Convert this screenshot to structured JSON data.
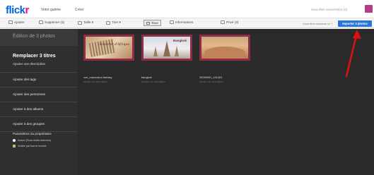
{
  "header": {
    "logo_main": "flick",
    "logo_accent": "r",
    "nav": [
      "Votre galerie",
      "Créer"
    ],
    "user_text": "Vous êtes connecté(e) (s)"
  },
  "toolbar": {
    "add_label": "Ajouter",
    "remove_label": "Supprimer (3)",
    "size_label": "Taille ▾",
    "sort_label": "Trier ▾",
    "all_label": "Tous",
    "info_label": "Informations",
    "privacy_label": "Privé (3)",
    "note": "Vous êtes nouveau ici ?",
    "publish_label": "Importer 3 photos"
  },
  "sidebar": {
    "header": "Édition de 3 photos",
    "title": "Remplacer 3 titres",
    "description": "Ajouter une description",
    "sections": [
      "Ajouter des tags",
      "Ajouter des personnes",
      "Ajouter à des albums",
      "Ajouter à des groupes"
    ],
    "permissions_title": "Paramètres du propriétaire",
    "permission_options": [
      "Aucun (Tous droits réservés)",
      "Visible par tout le monde"
    ]
  },
  "photos": [
    {
      "name": "voe_marocaine-fantasy",
      "description": "Ajouter une description",
      "overlay": "Souvenir d'Afrique"
    },
    {
      "name": "bangkok",
      "description": "Ajouter une description",
      "overlay": "Bangkok"
    },
    {
      "name": "20090901_101401",
      "description": "Ajouter une description",
      "overlay": ""
    }
  ],
  "colors": {
    "accent_blue": "#2a76d8",
    "thumb_frame": "#8e2c46",
    "arrow": "#e01010"
  }
}
